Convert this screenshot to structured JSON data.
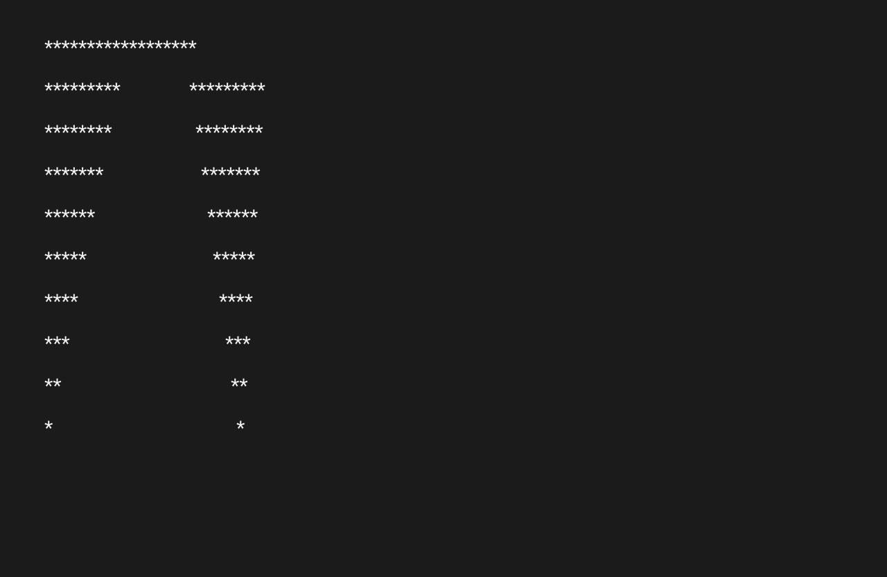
{
  "console": {
    "lines": [
      {
        "left": "******************",
        "right": ""
      },
      {
        "left": "*********",
        "right": "*********"
      },
      {
        "left": "********",
        "right": "********"
      },
      {
        "left": "*******",
        "right": "*******"
      },
      {
        "left": "******",
        "right": "******"
      },
      {
        "left": "*****",
        "right": "*****"
      },
      {
        "left": "****",
        "right": "****"
      },
      {
        "left": "***",
        "right": "***"
      },
      {
        "left": "**",
        "right": "**"
      },
      {
        "left": "*",
        "right": "*"
      }
    ]
  }
}
